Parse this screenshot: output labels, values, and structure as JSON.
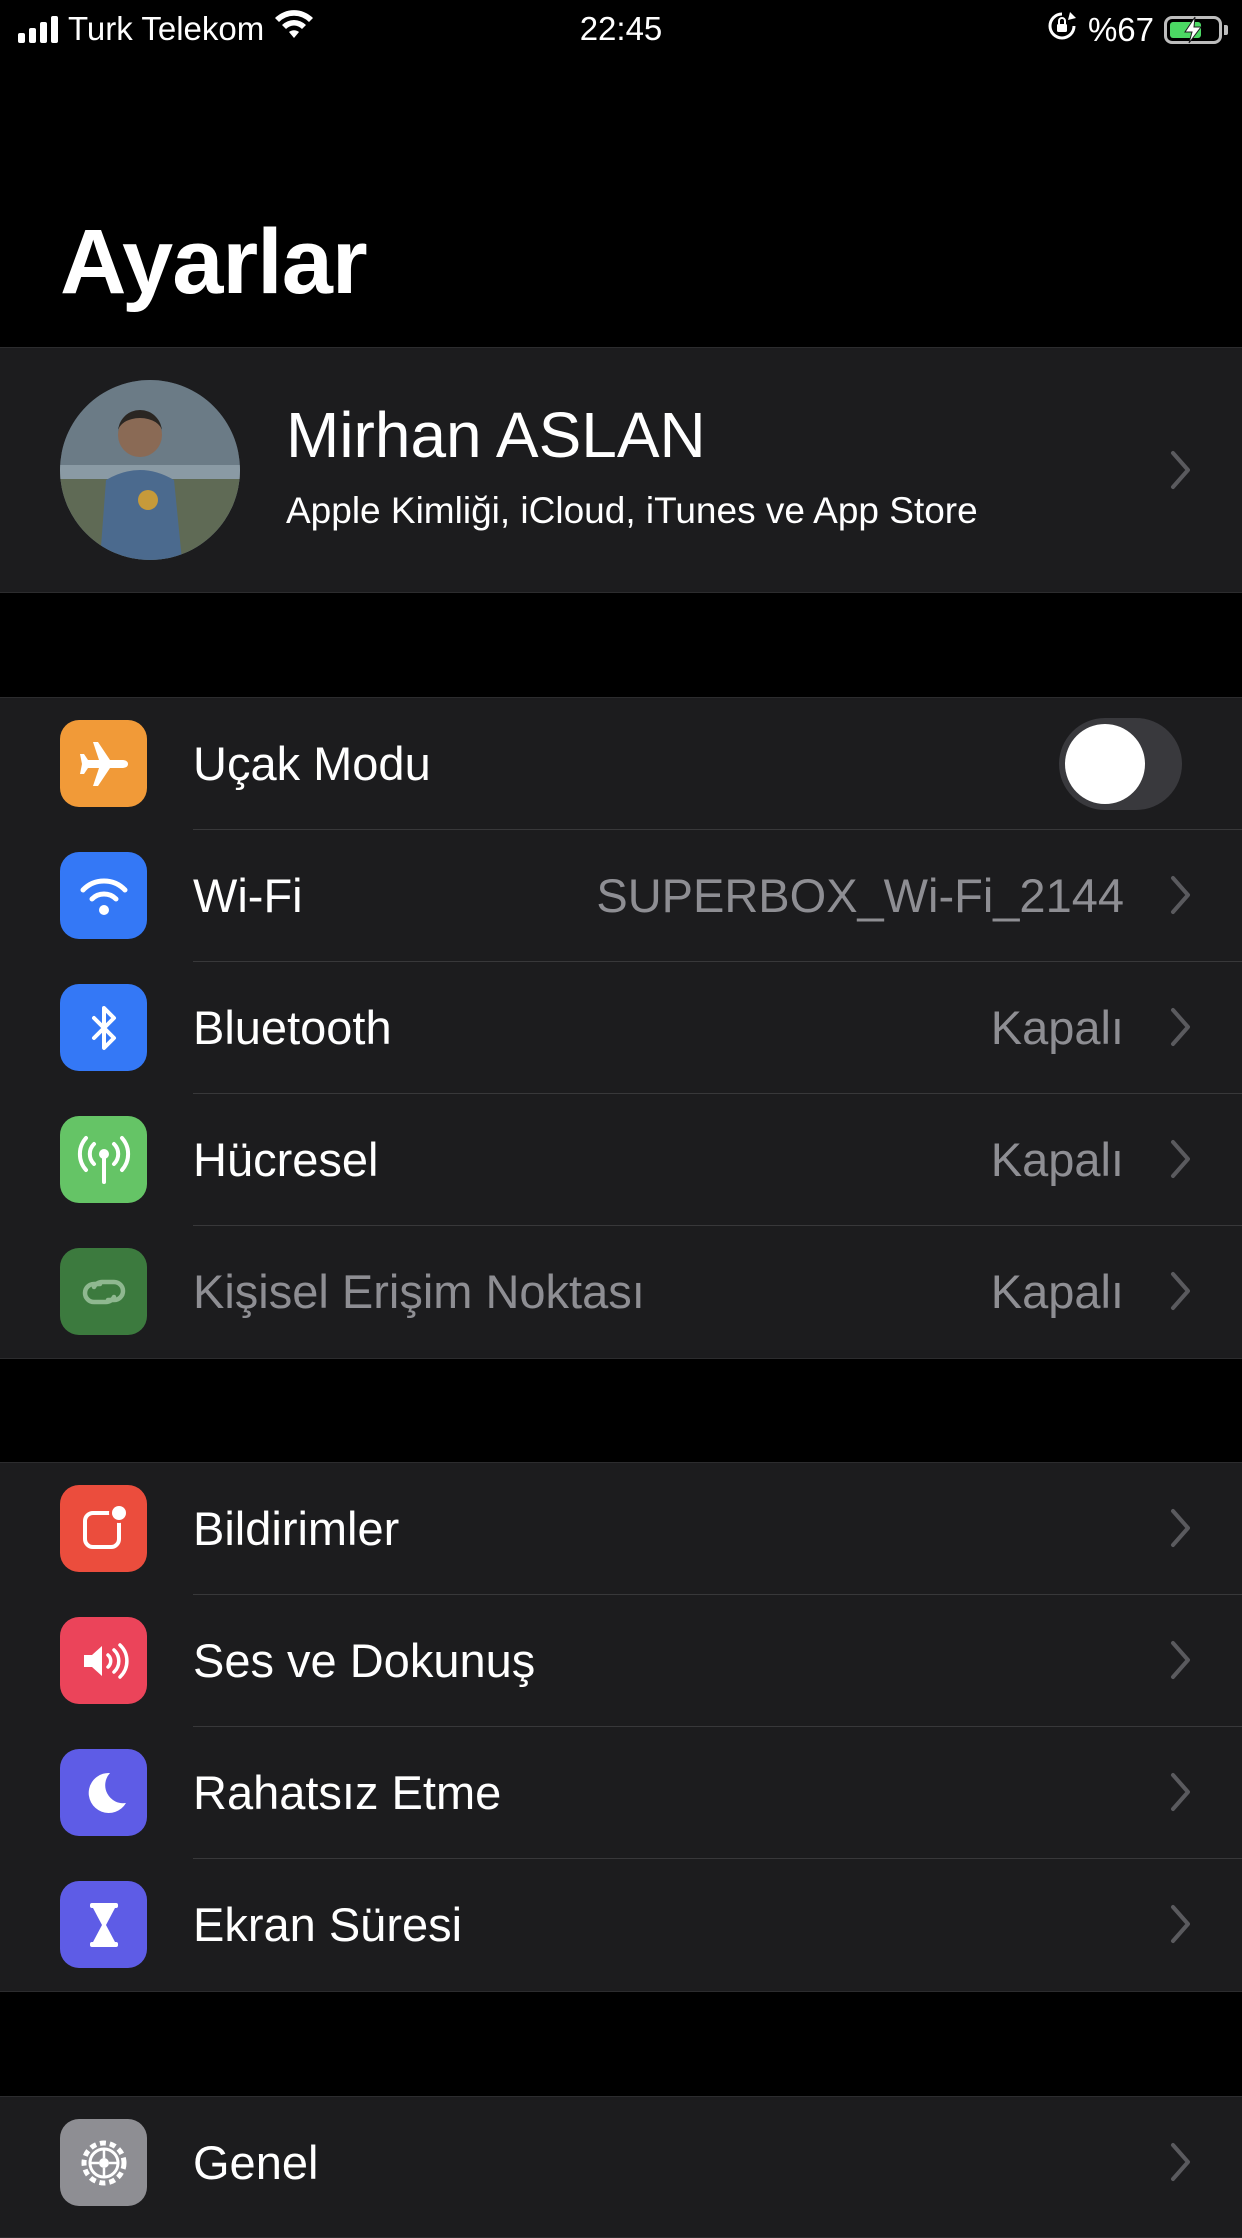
{
  "status_bar": {
    "carrier": "Turk Telekom",
    "time": "22:45",
    "battery_percent": "%67",
    "battery_level": 0.67
  },
  "page_title": "Ayarlar",
  "profile": {
    "name": "Mirhan ASLAN",
    "subtitle": "Apple Kimliği, iCloud, iTunes ve App Store"
  },
  "connectivity": [
    {
      "label": "Uçak Modu",
      "icon": "airplane-icon",
      "color": "#f19a38",
      "toggle": false
    },
    {
      "label": "Wi-Fi",
      "icon": "wifi-icon",
      "color": "#3478f6",
      "value": "SUPERBOX_Wi-Fi_2144"
    },
    {
      "label": "Bluetooth",
      "icon": "bluetooth-icon",
      "color": "#3478f6",
      "value": "Kapalı"
    },
    {
      "label": "Hücresel",
      "icon": "cellular-antenna-icon",
      "color": "#65c466",
      "value": "Kapalı"
    },
    {
      "label": "Kişisel Erişim Noktası",
      "icon": "hotspot-link-icon",
      "color": "#3c7a3e",
      "value": "Kapalı"
    }
  ],
  "notifications": [
    {
      "label": "Bildirimler",
      "icon": "notifications-icon",
      "color": "#eb4d3d"
    },
    {
      "label": "Ses ve Dokunuş",
      "icon": "speaker-icon",
      "color": "#eb445a"
    },
    {
      "label": "Rahatsız Etme",
      "icon": "moon-icon",
      "color": "#5e5ce6"
    },
    {
      "label": "Ekran Süresi",
      "icon": "hourglass-icon",
      "color": "#5e5ce6"
    }
  ],
  "general": [
    {
      "label": "Genel",
      "icon": "gear-icon",
      "color": "#8e8e93"
    }
  ]
}
